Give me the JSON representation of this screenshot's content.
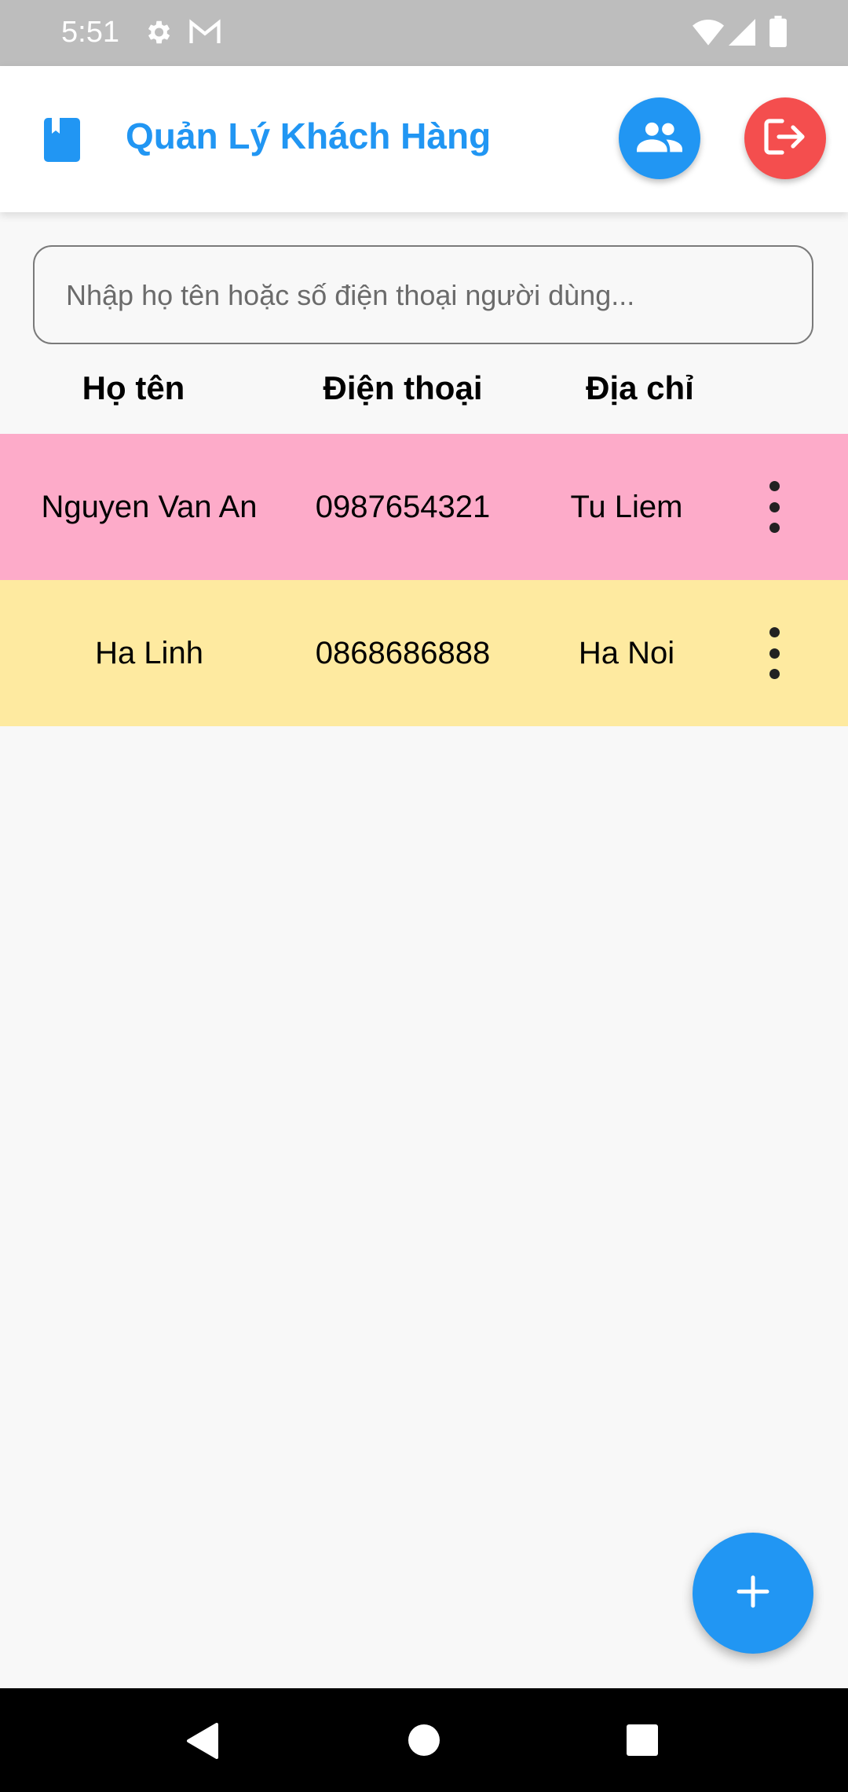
{
  "status_bar": {
    "time": "5:51",
    "icons": [
      "gear-icon",
      "gmail-icon",
      "wifi-icon",
      "signal-icon",
      "battery-icon"
    ]
  },
  "app_bar": {
    "logo_icon": "book-icon",
    "title": "Quản Lý Khách Hàng",
    "users_button_icon": "people-icon",
    "logout_button_icon": "logout-icon"
  },
  "search": {
    "value": "",
    "placeholder": "Nhập họ tên hoặc số điện thoại người dùng..."
  },
  "table": {
    "headers": [
      "Họ tên",
      "Điện thoại",
      "Địa chỉ"
    ],
    "rows": [
      {
        "name": "Nguyen Van An",
        "phone": "0987654321",
        "address": "Tu Liem",
        "menu_icon": "more-vert-icon"
      },
      {
        "name": "Ha Linh",
        "phone": "0868686888",
        "address": "Ha Noi",
        "menu_icon": "more-vert-icon"
      }
    ]
  },
  "fab": {
    "icon": "plus-icon"
  },
  "nav_bar": {
    "icons": [
      "back-icon",
      "home-icon",
      "recents-icon"
    ]
  },
  "colors": {
    "primary": "#2196F3",
    "danger": "#F44E4E",
    "row_1": "#FDABC9",
    "row_2": "#FEEAA0",
    "status_bar": "#BDBDBD",
    "background": "#F8F8F8"
  }
}
